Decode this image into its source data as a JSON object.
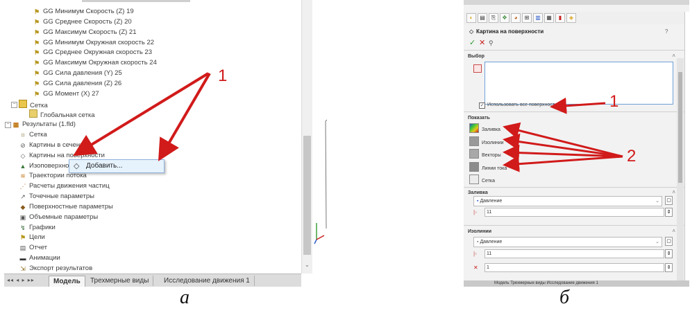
{
  "panel_a": {
    "tree_items": [
      {
        "label": "GG Минимум Скорость (Z) 19",
        "icon": "goal-icon"
      },
      {
        "label": "GG Среднее Скорость (Z) 20",
        "icon": "goal-icon"
      },
      {
        "label": "GG Максимум Скорость (Z) 21",
        "icon": "goal-icon"
      },
      {
        "label": "GG Минимум Окружная скорость 22",
        "icon": "goal-icon"
      },
      {
        "label": "GG Среднее Окружная скорость 23",
        "icon": "goal-icon"
      },
      {
        "label": "GG Максимум Окружная скорость 24",
        "icon": "goal-icon"
      },
      {
        "label": "GG Сила давления (Y) 25",
        "icon": "goal-icon"
      },
      {
        "label": "GG Сила давления (Z) 26",
        "icon": "goal-icon"
      },
      {
        "label": "GG Момент (X) 27",
        "icon": "goal-icon"
      },
      {
        "label": "Сетка",
        "icon": "mesh-folder-icon"
      },
      {
        "label": "Глобальная сетка",
        "icon": "global-mesh-icon"
      },
      {
        "label": "Результаты (1.fld)",
        "icon": "results-icon"
      },
      {
        "label": "Сетка",
        "icon": "mesh-icon"
      },
      {
        "label": "Картины в сечениях",
        "icon": "cut-plot-icon"
      },
      {
        "label": "Картины на поверхности",
        "icon": "surface-plot-icon"
      },
      {
        "label": "Изоповерхности",
        "icon": "isosurface-icon"
      },
      {
        "label": "Траектории потока",
        "icon": "flow-trajectory-icon"
      },
      {
        "label": "Расчеты движения частиц",
        "icon": "particle-study-icon"
      },
      {
        "label": "Точечные параметры",
        "icon": "point-params-icon"
      },
      {
        "label": "Поверхностные параметры",
        "icon": "surface-params-icon"
      },
      {
        "label": "Объемные параметры",
        "icon": "volume-params-icon"
      },
      {
        "label": "Графики",
        "icon": "xy-plot-icon"
      },
      {
        "label": "Цели",
        "icon": "goals-icon"
      },
      {
        "label": "Отчет",
        "icon": "report-icon"
      },
      {
        "label": "Анимации",
        "icon": "animation-icon"
      },
      {
        "label": "Экспорт результатов",
        "icon": "export-results-icon"
      }
    ],
    "context_menu": {
      "item": "Добавить..."
    },
    "tabs": {
      "model": "Модель",
      "views_3d": "Трехмерные виды",
      "motion": "Исследование движения 1"
    },
    "callout": "1",
    "caption": "а"
  },
  "panel_b": {
    "pm_title": "Картина на поверхности",
    "ok": "✓",
    "cancel": "✕",
    "pin": "⚲",
    "sections": {
      "selection": "Выбор",
      "display": "Показать",
      "contours": "Заливка",
      "isolines": "Изолинии"
    },
    "use_all_faces": "Использовать все поверхности",
    "display_items": [
      "Заливка",
      "Изолинии",
      "Векторы",
      "Линии тока",
      "Сетка"
    ],
    "contours_param": "Давление",
    "contours_levels": "11",
    "isolines_param": "Давление",
    "isolines_levels": "11",
    "isolines_value": "1",
    "bottom_tabs": "Модель   Трехмерные виды   Исследование движения 1",
    "callout_1": "1",
    "callout_2": "2",
    "caption": "б"
  },
  "colors": {
    "arrow": "#d11a1a",
    "accent_blue": "#6ea0d8",
    "selection": "#e6f2fc"
  }
}
